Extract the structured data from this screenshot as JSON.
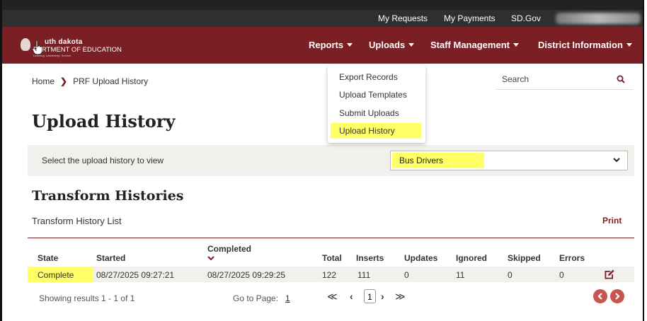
{
  "utility_nav": {
    "my_requests": "My Requests",
    "my_payments": "My Payments",
    "sd_gov": "SD.Gov"
  },
  "brand": {
    "line1": "uth dakota",
    "line2": "PARTMENT OF EDUCATION",
    "tagline": "Learning. Leadership. Service.",
    "color": "#7a1f24"
  },
  "main_nav": {
    "reports": "Reports",
    "uploads": "Uploads",
    "staff_management": "Staff Management",
    "district_information": "District Information"
  },
  "uploads_menu": {
    "items": [
      "Export Records",
      "Upload Templates",
      "Submit Uploads",
      "Upload History"
    ],
    "highlighted": "Upload History"
  },
  "breadcrumb": {
    "home": "Home",
    "current": "PRF Upload History"
  },
  "search": {
    "placeholder": "Search"
  },
  "page": {
    "title": "Upload History",
    "select_label": "Select the upload history to view",
    "select_value": "Bus Drivers",
    "section_title": "Transform Histories",
    "list_title": "Transform History List",
    "print": "Print"
  },
  "table": {
    "headers": {
      "state": "State",
      "started": "Started",
      "completed": "Completed",
      "total": "Total",
      "inserts": "Inserts",
      "updates": "Updates",
      "ignored": "Ignored",
      "skipped": "Skipped",
      "errors": "Errors"
    },
    "rows": [
      {
        "state": "Complete",
        "started": "08/27/2025 09:27:21",
        "completed": "08/27/2025 09:29:25",
        "total": "122",
        "inserts": "111",
        "updates": "0",
        "ignored": "11",
        "skipped": "0",
        "errors": "0"
      }
    ]
  },
  "pagination": {
    "showing": "Showing results 1 - 1 of 1",
    "go_to_page": "Go to Page:",
    "go_to_value": "1",
    "first": "≪",
    "prev": "‹",
    "current": "1",
    "next": "›",
    "last": "≫"
  },
  "colors": {
    "highlight": "#ffff66",
    "accent": "#7a1f24",
    "button": "#c9534f"
  }
}
